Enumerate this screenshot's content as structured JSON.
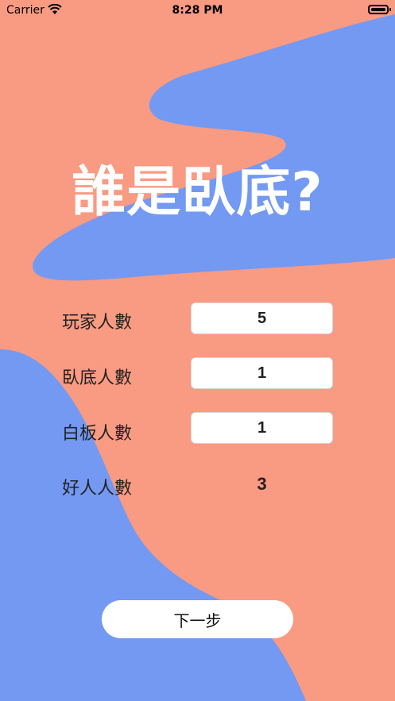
{
  "status_bar": {
    "carrier": "Carrier",
    "time": "8:28 PM"
  },
  "title": "誰是臥底?",
  "settings": {
    "players": {
      "label": "玩家人數",
      "value": "5"
    },
    "undercover": {
      "label": "臥底人數",
      "value": "1"
    },
    "blank": {
      "label": "白板人數",
      "value": "1"
    },
    "good": {
      "label": "好人人數",
      "value": "3"
    }
  },
  "next_button": "下一步",
  "colors": {
    "background_salmon": "#f99a82",
    "accent_blue": "#7399f2",
    "title_text": "#ffffff"
  }
}
